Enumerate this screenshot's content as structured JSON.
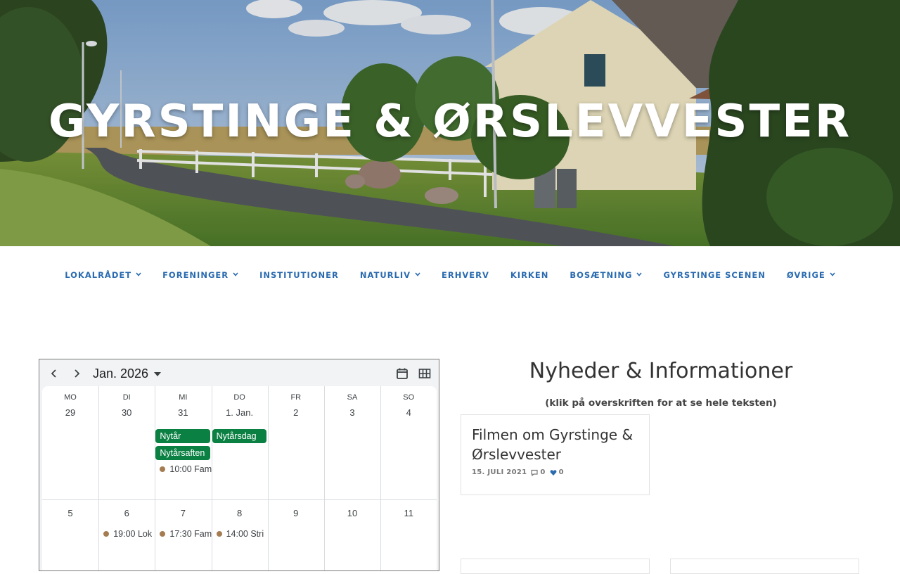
{
  "site": {
    "title": "GYRSTINGE & ØRSLEVVESTER"
  },
  "nav": [
    {
      "label": "LOKALRÅDET",
      "dropdown": true
    },
    {
      "label": "FORENINGER",
      "dropdown": true
    },
    {
      "label": "INSTITUTIONER",
      "dropdown": false
    },
    {
      "label": "NATURLIV",
      "dropdown": true
    },
    {
      "label": "ERHVERV",
      "dropdown": false
    },
    {
      "label": "KIRKEN",
      "dropdown": false
    },
    {
      "label": "BOSÆTNING",
      "dropdown": true
    },
    {
      "label": "GYRSTINGE SCENEN",
      "dropdown": false
    },
    {
      "label": "ØVRIGE",
      "dropdown": true
    }
  ],
  "calendar": {
    "month_label": "Jan. 2026",
    "weekdays": [
      "MO",
      "DI",
      "MI",
      "DO",
      "FR",
      "SA",
      "SO"
    ],
    "weeks": [
      [
        "29",
        "30",
        "31",
        "1. Jan.",
        "2",
        "3",
        "4"
      ],
      [
        "5",
        "6",
        "7",
        "8",
        "9",
        "10",
        "11"
      ]
    ],
    "chip_color": "#0b8043",
    "dot_color": "#a57c52",
    "events": [
      {
        "week": 0,
        "day": 2,
        "slot": 0,
        "kind": "chip",
        "text": "Nytår"
      },
      {
        "week": 0,
        "day": 3,
        "slot": 0,
        "kind": "chip",
        "text": "Nytårsdag"
      },
      {
        "week": 0,
        "day": 2,
        "slot": 1,
        "kind": "chip",
        "text": "Nytårsaften"
      },
      {
        "week": 0,
        "day": 2,
        "slot": 2,
        "kind": "dot",
        "text": "10:00 Fam"
      },
      {
        "week": 1,
        "day": 1,
        "slot": 0,
        "kind": "dot",
        "text": "19:00 Lok"
      },
      {
        "week": 1,
        "day": 2,
        "slot": 0,
        "kind": "dot",
        "text": "17:30 Fam"
      },
      {
        "week": 1,
        "day": 3,
        "slot": 0,
        "kind": "dot",
        "text": "14:00 Stri"
      }
    ]
  },
  "news": {
    "heading": "Nyheder & Informationer",
    "subheading": "(klik på overskriften for at se hele teksten)",
    "posts": [
      {
        "title": "Filmen om Gyrstinge & Ørslevvester",
        "date": "15. JULI 2021",
        "comments": "0",
        "likes": "0"
      }
    ]
  },
  "colors": {
    "nav_link": "#2a6bb0",
    "like_heart": "#2a6bb0"
  }
}
